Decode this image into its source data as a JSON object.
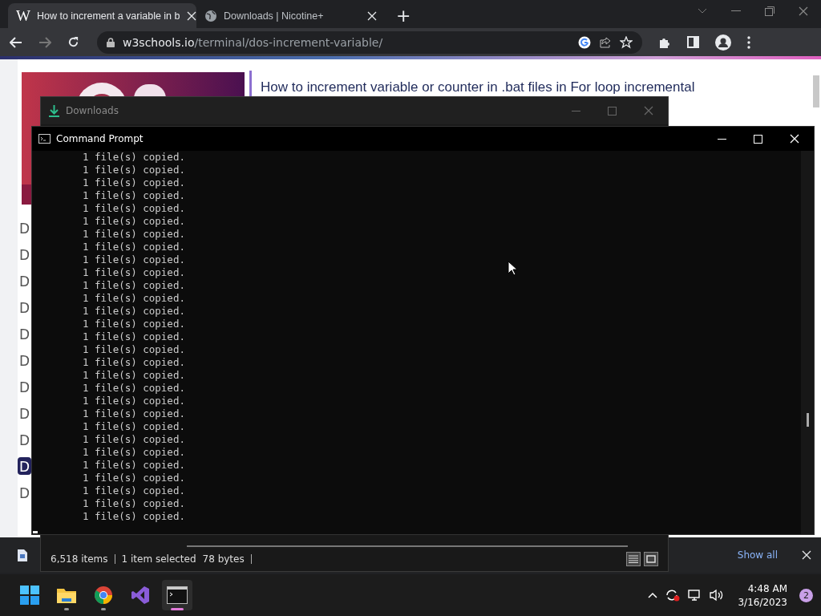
{
  "browser": {
    "tabs": [
      {
        "icon": "W",
        "title": "How to increment a variable in b",
        "selected": true
      },
      {
        "title": "Downloads | Nicotine+",
        "selected": false
      }
    ],
    "new_tab": "+",
    "url": {
      "host": "w3schools.io",
      "path": "/terminal/dos-increment-variable/"
    }
  },
  "page": {
    "title": "How to increment variable or counter in .bat files in For loop incremental",
    "sidebar_items": [
      {
        "label": "D",
        "selected": false
      },
      {
        "label": "D",
        "selected": false
      },
      {
        "label": "D",
        "selected": false
      },
      {
        "label": "D",
        "selected": false
      },
      {
        "label": "D",
        "selected": false
      },
      {
        "label": "D",
        "selected": false
      },
      {
        "label": "D",
        "selected": false
      },
      {
        "label": "D",
        "selected": false
      },
      {
        "label": "D",
        "selected": false
      },
      {
        "label": "D",
        "selected": true
      },
      {
        "label": "D",
        "selected": false
      }
    ]
  },
  "downloads_window": {
    "title": "Downloads",
    "status": {
      "items": "6,518 items",
      "selection": "1 item selected",
      "size": "78 bytes"
    }
  },
  "command_prompt": {
    "title": "Command Prompt",
    "lines": [
      "1 file(s) copied.",
      "1 file(s) copied.",
      "1 file(s) copied.",
      "1 file(s) copied.",
      "1 file(s) copied.",
      "1 file(s) copied.",
      "1 file(s) copied.",
      "1 file(s) copied.",
      "1 file(s) copied.",
      "1 file(s) copied.",
      "1 file(s) copied.",
      "1 file(s) copied.",
      "1 file(s) copied.",
      "1 file(s) copied.",
      "1 file(s) copied.",
      "1 file(s) copied.",
      "1 file(s) copied.",
      "1 file(s) copied.",
      "1 file(s) copied.",
      "1 file(s) copied.",
      "1 file(s) copied.",
      "1 file(s) copied.",
      "1 file(s) copied.",
      "1 file(s) copied.",
      "1 file(s) copied.",
      "1 file(s) copied.",
      "1 file(s) copied.",
      "1 file(s) copied.",
      "1 file(s) copied."
    ]
  },
  "download_bar": {
    "show_all": "Show all"
  },
  "taskbar": {
    "apps": [
      {
        "kind": "start",
        "running": false,
        "selected": false
      },
      {
        "kind": "explorer",
        "running": true,
        "selected": false
      },
      {
        "kind": "chrome",
        "running": true,
        "selected": false
      },
      {
        "kind": "visual-studio",
        "running": false,
        "selected": false
      },
      {
        "kind": "terminal",
        "running": true,
        "selected": true
      }
    ],
    "time": "4:48 AM",
    "date": "3/16/2023",
    "notifications": "2"
  }
}
